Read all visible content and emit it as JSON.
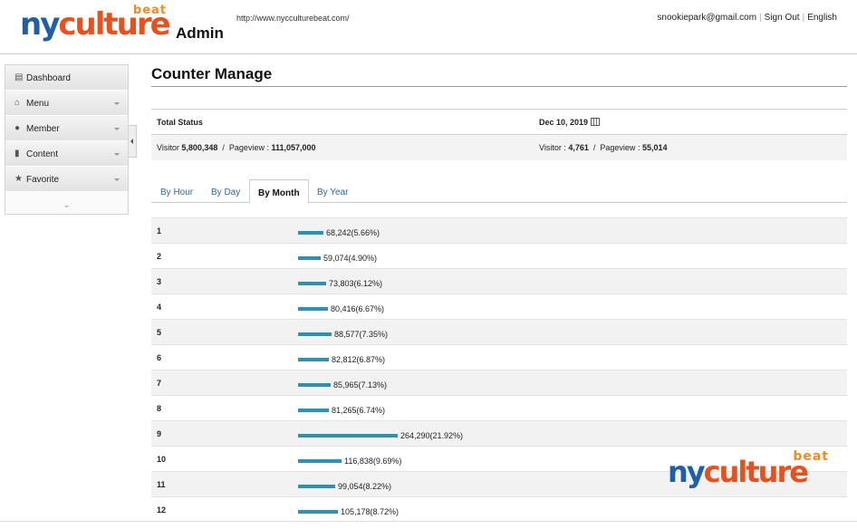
{
  "header": {
    "logo": {
      "beat": "beat",
      "ny": "ny",
      "culture": "culture"
    },
    "admin_title": "Admin",
    "site_url": "http://www.nycculturebeat.com/",
    "user_email": "snookiepark@gmail.com",
    "sign_out": "Sign Out",
    "language": "English"
  },
  "sidebar": {
    "items": [
      {
        "label": "Dashboard",
        "icon": "dashboard-icon"
      },
      {
        "label": "Menu",
        "icon": "home-icon"
      },
      {
        "label": "Member",
        "icon": "user-icon"
      },
      {
        "label": "Content",
        "icon": "document-icon"
      },
      {
        "label": "Favorite",
        "icon": "star-icon"
      }
    ]
  },
  "main": {
    "title": "Counter Manage",
    "status": {
      "total_label": "Total Status",
      "date": "Dec 10, 2019",
      "visitor_label": "Visitor",
      "pageview_label": "Pageview",
      "total_visitor": "5,800,348",
      "total_pageview": "111,057,000",
      "day_visitor": "4,761",
      "day_pageview": "55,014"
    },
    "tabs": [
      {
        "label": "By Hour"
      },
      {
        "label": "By Day"
      },
      {
        "label": "By Month",
        "active": true
      },
      {
        "label": "By Year"
      }
    ],
    "rows": [
      {
        "month": "1",
        "text": "68,242(5.66%)",
        "pct": 5.66
      },
      {
        "month": "2",
        "text": "59,074(4.90%)",
        "pct": 4.9
      },
      {
        "month": "3",
        "text": "73,803(6.12%)",
        "pct": 6.12
      },
      {
        "month": "4",
        "text": "80,416(6.67%)",
        "pct": 6.67
      },
      {
        "month": "5",
        "text": "88,577(7.35%)",
        "pct": 7.35
      },
      {
        "month": "6",
        "text": "82,812(6.87%)",
        "pct": 6.87
      },
      {
        "month": "7",
        "text": "85,965(7.13%)",
        "pct": 7.13
      },
      {
        "month": "8",
        "text": "81,265(6.74%)",
        "pct": 6.74
      },
      {
        "month": "9",
        "text": "264,290(21.92%)",
        "pct": 21.92
      },
      {
        "month": "10",
        "text": "116,838(9.69%)",
        "pct": 9.69
      },
      {
        "month": "11",
        "text": "99,054(8.22%)",
        "pct": 8.22
      },
      {
        "month": "12",
        "text": "105,178(8.72%)",
        "pct": 8.72
      }
    ]
  },
  "colors": {
    "bar": "#2a93b5",
    "logo_blue": "#1f5fa8",
    "logo_red": "#e8501d",
    "logo_orange": "#f08a24"
  }
}
